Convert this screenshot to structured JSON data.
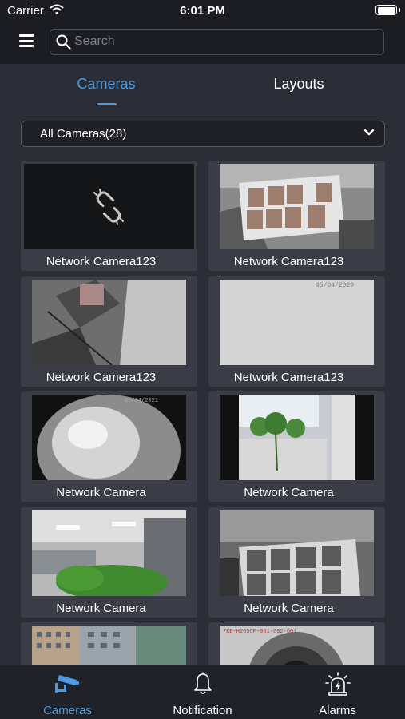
{
  "status_bar": {
    "carrier": "Carrier",
    "time": "6:01 PM"
  },
  "search": {
    "placeholder": "Search",
    "value": ""
  },
  "tabs": [
    {
      "label": "Cameras",
      "active": true
    },
    {
      "label": "Layouts",
      "active": false
    }
  ],
  "filter": {
    "selected": "All Cameras(28)"
  },
  "cameras": [
    {
      "name": "Network Camera123",
      "thumb": "broken-link"
    },
    {
      "name": "Network Camera123",
      "thumb": "faces-board"
    },
    {
      "name": "Network Camera123",
      "thumb": "office-tilted"
    },
    {
      "name": "Network Camera123",
      "thumb": "blank-wall"
    },
    {
      "name": "Network Camera",
      "thumb": "fisheye-dome"
    },
    {
      "name": "Network Camera",
      "thumb": "plant-window"
    },
    {
      "name": "Network Camera",
      "thumb": "office-plants"
    },
    {
      "name": "Network Camera",
      "thumb": "faces-screen"
    },
    {
      "name": "",
      "thumb": "buildings"
    },
    {
      "name": "",
      "thumb": "lens-closeup"
    }
  ],
  "thumb_overlays": {
    "blank_wall_date": "05/04/2020",
    "fisheye_date": "04/04/2021",
    "lens_caption": "7KB-H265CF-001-002-001"
  },
  "bottom_tabs": [
    {
      "label": "Cameras",
      "icon": "cctv-camera-icon",
      "active": true
    },
    {
      "label": "Notification",
      "icon": "bell-icon",
      "active": false
    },
    {
      "label": "Alarms",
      "icon": "siren-icon",
      "active": false
    }
  ],
  "colors": {
    "accent": "#4a9be3",
    "background": "#1b1d23",
    "panel": "#2b2e36",
    "tile": "#3a3d45"
  }
}
